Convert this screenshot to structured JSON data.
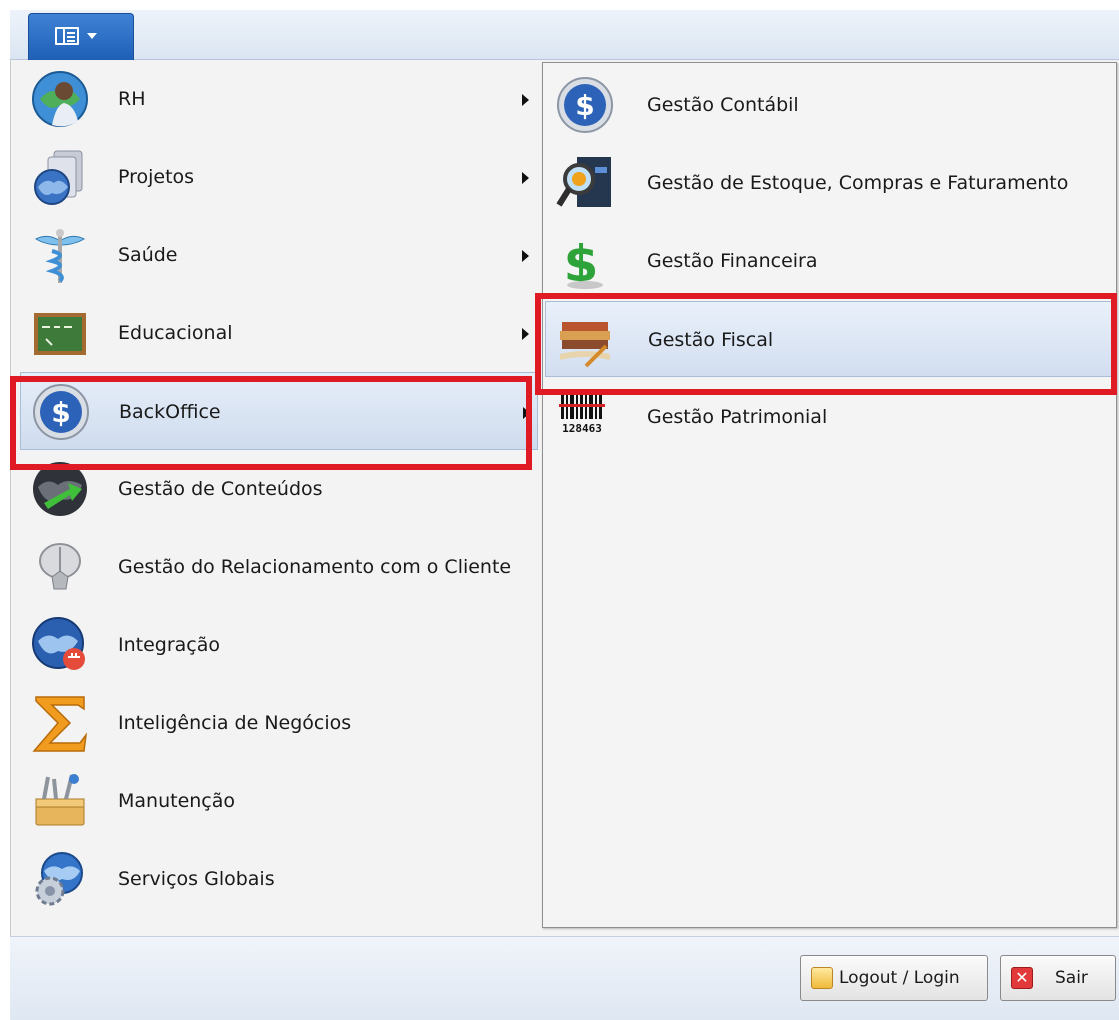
{
  "menu": {
    "items": [
      {
        "label": "RH",
        "icon": "person-globe-icon",
        "has_submenu": true
      },
      {
        "label": "Projetos",
        "icon": "globe-documents-icon",
        "has_submenu": true
      },
      {
        "label": "Saúde",
        "icon": "caduceus-icon",
        "has_submenu": true
      },
      {
        "label": "Educacional",
        "icon": "chalkboard-icon",
        "has_submenu": true
      },
      {
        "label": "BackOffice",
        "icon": "dollar-coin-icon",
        "has_submenu": true,
        "selected": true
      },
      {
        "label": "Gestão de Conteúdos",
        "icon": "globe-arrow-icon",
        "has_submenu": false
      },
      {
        "label": "Gestão do Relacionamento com o Cliente",
        "icon": "satellite-dish-icon",
        "has_submenu": false
      },
      {
        "label": "Integração",
        "icon": "globe-plug-icon",
        "has_submenu": false
      },
      {
        "label": "Inteligência de Negócios",
        "icon": "sigma-icon",
        "has_submenu": false
      },
      {
        "label": "Manutenção",
        "icon": "toolbox-icon",
        "has_submenu": false
      },
      {
        "label": "Serviços Globais",
        "icon": "globe-gear-icon",
        "has_submenu": false
      }
    ]
  },
  "submenu": {
    "items": [
      {
        "label": "Gestão Contábil",
        "icon": "dollar-coin-icon"
      },
      {
        "label": "Gestão de Estoque, Compras e Faturamento",
        "icon": "magnifier-report-icon"
      },
      {
        "label": "Gestão Financeira",
        "icon": "green-dollar-icon"
      },
      {
        "label": "Gestão Fiscal",
        "icon": "books-pen-icon",
        "selected": true
      },
      {
        "label": "Gestão Patrimonial",
        "icon": "barcode-icon",
        "barcode_text": "128463"
      }
    ]
  },
  "footer": {
    "logout_label": "Logout / Login",
    "exit_label": "Sair",
    "exit_icon_glyph": "✕"
  },
  "colors": {
    "highlight": "#e01a24",
    "app_button": "#2a6cc4"
  }
}
